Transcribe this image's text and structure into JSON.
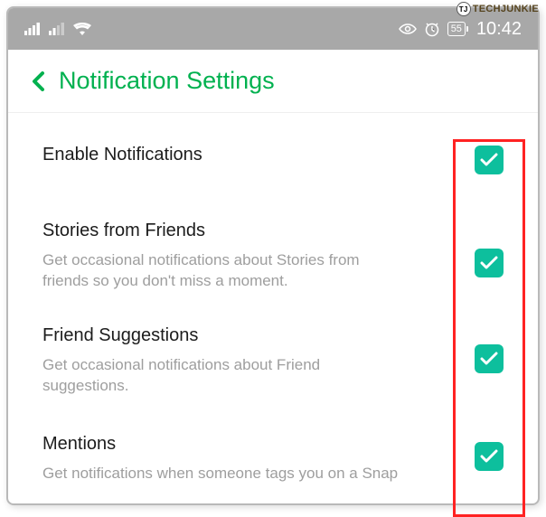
{
  "watermark": {
    "text": "TECHJUNKIE"
  },
  "statusbar": {
    "battery": "55",
    "time": "10:42"
  },
  "header": {
    "title": "Notification Settings"
  },
  "settings": [
    {
      "title": "Enable Notifications",
      "desc": "",
      "checked": true
    },
    {
      "title": "Stories from Friends",
      "desc": "Get occasional notifications about Stories from friends so you don't miss a moment.",
      "checked": true
    },
    {
      "title": "Friend Suggestions",
      "desc": "Get occasional notifications about Friend suggestions.",
      "checked": true
    },
    {
      "title": "Mentions",
      "desc": "Get notifications when someone tags you on a Snap",
      "checked": true
    }
  ]
}
